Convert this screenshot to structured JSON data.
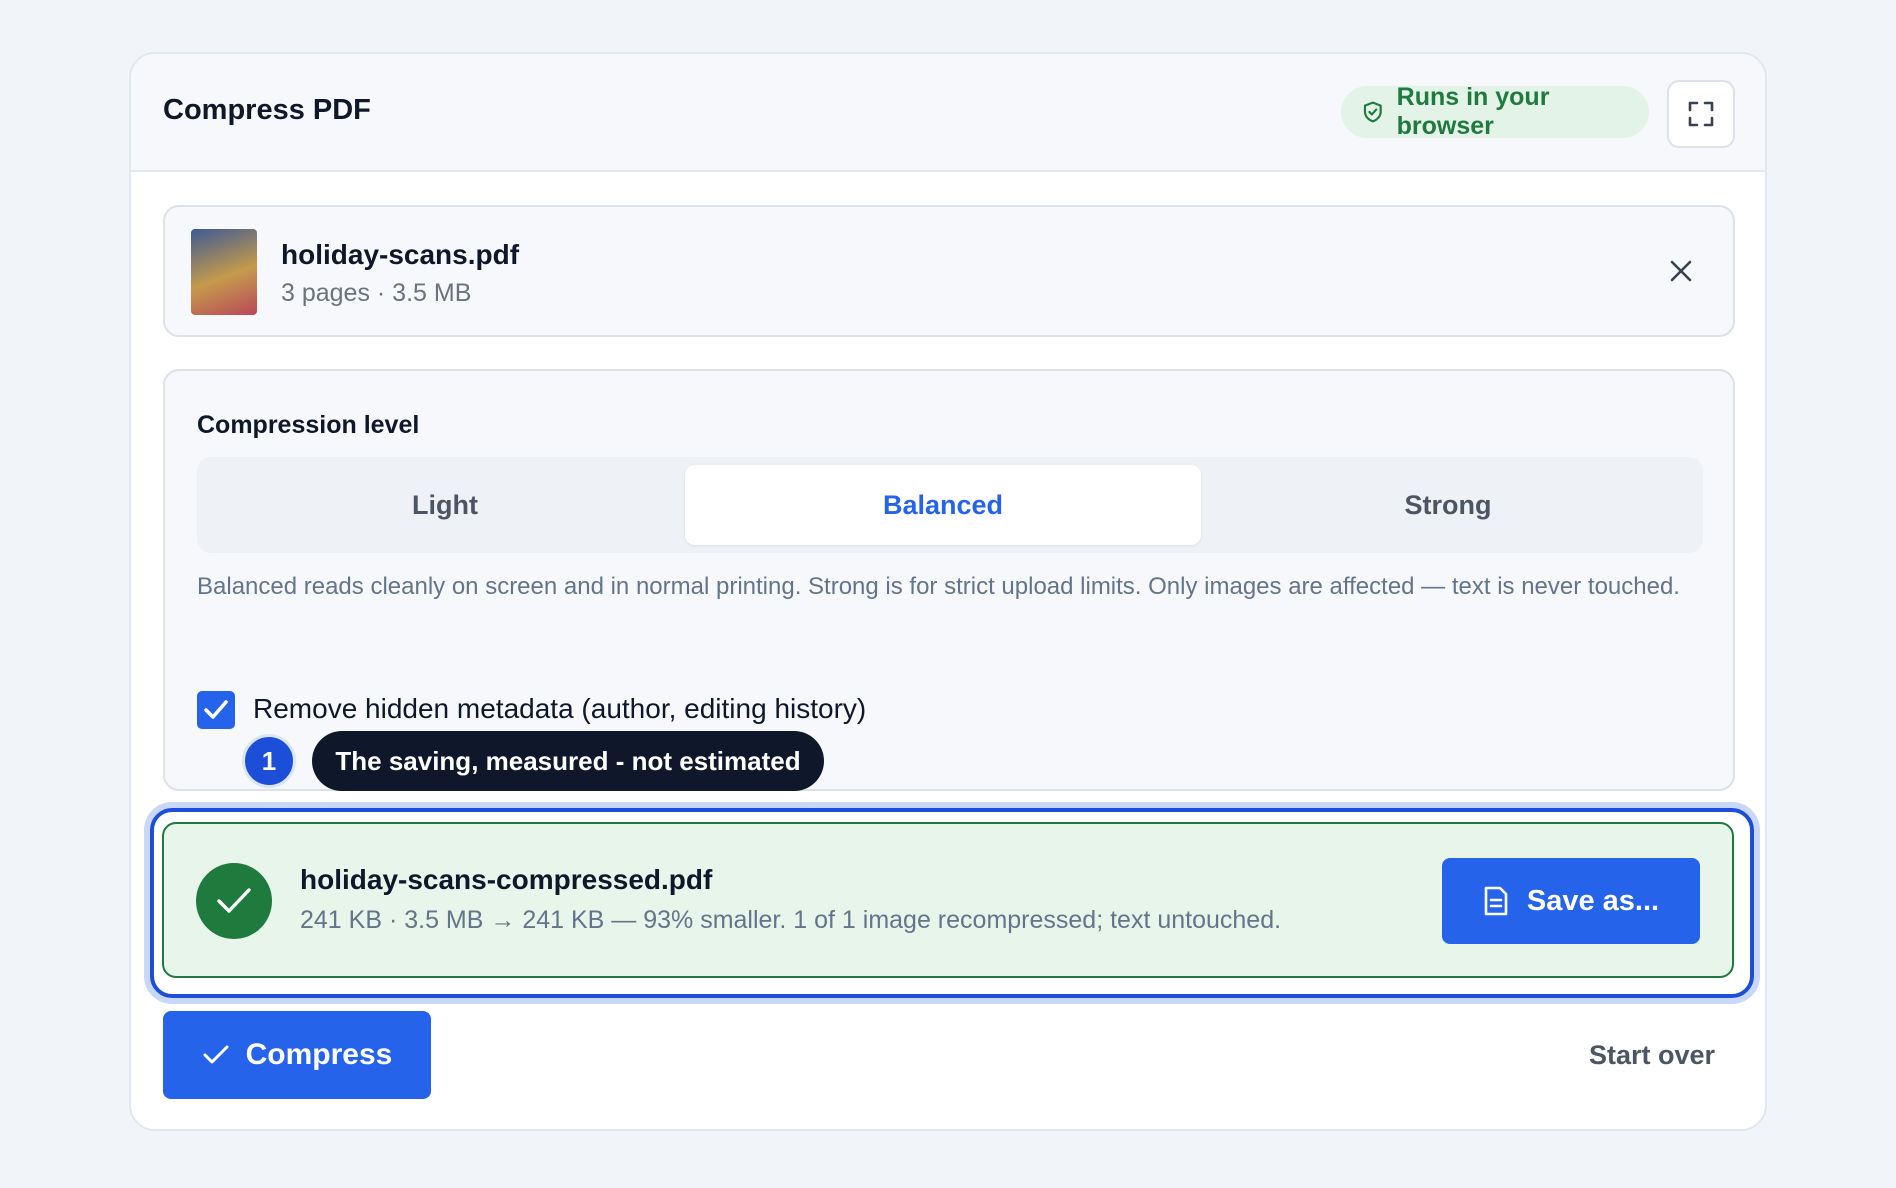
{
  "header": {
    "title": "Compress PDF",
    "badge": "Runs in your browser",
    "badge_icon": "shield-check-icon",
    "fullscreen_icon": "expand-icon"
  },
  "file": {
    "name": "holiday-scans.pdf",
    "meta": "3 pages · 3.5 MB",
    "remove_icon": "close-icon"
  },
  "compression": {
    "label": "Compression level",
    "options": [
      "Light",
      "Balanced",
      "Strong"
    ],
    "selected": "Balanced",
    "description": "Balanced reads cleanly on screen and in normal printing. Strong is for strict upload limits. Only images are affected — text is never touched."
  },
  "metadata_option": {
    "label": "Remove hidden metadata (author, editing history)",
    "checked": true
  },
  "annotation": {
    "step": "1",
    "text": "The saving, measured - not estimated"
  },
  "result": {
    "name": "holiday-scans-compressed.pdf",
    "meta": "241 KB · 3.5 MB → 241 KB — 93% smaller. 1 of 1 image recompressed; text untouched.",
    "save_label": "Save as..."
  },
  "actions": {
    "compress_label": "Compress",
    "start_over_label": "Start over"
  },
  "colors": {
    "accent": "#2563eb",
    "success": "#1f7a3d",
    "success_bg": "#e8f5ea"
  }
}
